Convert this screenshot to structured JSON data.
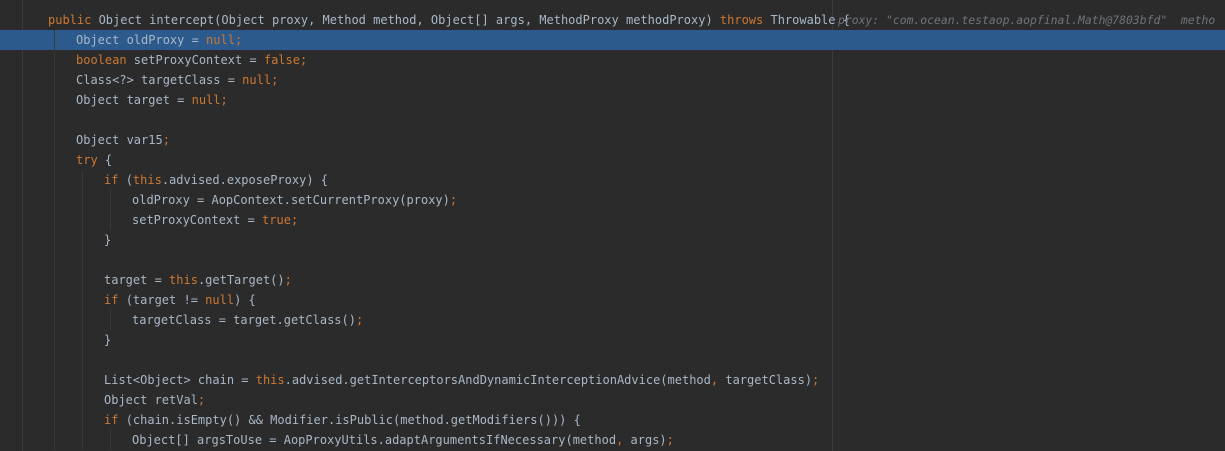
{
  "editor": {
    "inline_hint": "proxy: \"com.ocean.testaop.aopfinal.Math@7803bfd\"  metho",
    "lines": [
      {
        "indent": 1,
        "current": false,
        "tokens": [
          {
            "t": "public ",
            "c": "kw"
          },
          {
            "t": "Object intercept(Object proxy, Method method, Object[] args, MethodProxy methodProxy) ",
            "c": "pl"
          },
          {
            "t": "throws ",
            "c": "kw"
          },
          {
            "t": "Throwable {",
            "c": "pl"
          }
        ]
      },
      {
        "indent": 2,
        "current": true,
        "tokens": [
          {
            "t": "Object oldProxy = ",
            "c": "pl"
          },
          {
            "t": "null",
            "c": "kw"
          },
          {
            "t": ";",
            "c": "kw"
          }
        ]
      },
      {
        "indent": 2,
        "current": false,
        "tokens": [
          {
            "t": "boolean ",
            "c": "kw"
          },
          {
            "t": "setProxyContext = ",
            "c": "pl"
          },
          {
            "t": "false",
            "c": "kw"
          },
          {
            "t": ";",
            "c": "kw"
          }
        ]
      },
      {
        "indent": 2,
        "current": false,
        "tokens": [
          {
            "t": "Class<?> targetClass = ",
            "c": "pl"
          },
          {
            "t": "null",
            "c": "kw"
          },
          {
            "t": ";",
            "c": "kw"
          }
        ]
      },
      {
        "indent": 2,
        "current": false,
        "tokens": [
          {
            "t": "Object target = ",
            "c": "pl"
          },
          {
            "t": "null",
            "c": "kw"
          },
          {
            "t": ";",
            "c": "kw"
          }
        ]
      },
      {
        "indent": 2,
        "current": false,
        "tokens": []
      },
      {
        "indent": 2,
        "current": false,
        "tokens": [
          {
            "t": "Object var15",
            "c": "pl"
          },
          {
            "t": ";",
            "c": "kw"
          }
        ]
      },
      {
        "indent": 2,
        "current": false,
        "tokens": [
          {
            "t": "try ",
            "c": "kw"
          },
          {
            "t": "{",
            "c": "pl"
          }
        ]
      },
      {
        "indent": 3,
        "current": false,
        "tokens": [
          {
            "t": "if ",
            "c": "kw"
          },
          {
            "t": "(",
            "c": "pl"
          },
          {
            "t": "this",
            "c": "kw"
          },
          {
            "t": ".advised.exposeProxy) {",
            "c": "pl"
          }
        ]
      },
      {
        "indent": 4,
        "current": false,
        "tokens": [
          {
            "t": "oldProxy = AopContext.setCurrentProxy(proxy)",
            "c": "pl"
          },
          {
            "t": ";",
            "c": "kw"
          }
        ]
      },
      {
        "indent": 4,
        "current": false,
        "tokens": [
          {
            "t": "setProxyContext = ",
            "c": "pl"
          },
          {
            "t": "true",
            "c": "kw"
          },
          {
            "t": ";",
            "c": "kw"
          }
        ]
      },
      {
        "indent": 3,
        "current": false,
        "tokens": [
          {
            "t": "}",
            "c": "pl"
          }
        ]
      },
      {
        "indent": 3,
        "current": false,
        "tokens": []
      },
      {
        "indent": 3,
        "current": false,
        "tokens": [
          {
            "t": "target = ",
            "c": "pl"
          },
          {
            "t": "this",
            "c": "kw"
          },
          {
            "t": ".getTarget()",
            "c": "pl"
          },
          {
            "t": ";",
            "c": "kw"
          }
        ]
      },
      {
        "indent": 3,
        "current": false,
        "tokens": [
          {
            "t": "if ",
            "c": "kw"
          },
          {
            "t": "(target != ",
            "c": "pl"
          },
          {
            "t": "null",
            "c": "kw"
          },
          {
            "t": ") {",
            "c": "pl"
          }
        ]
      },
      {
        "indent": 4,
        "current": false,
        "tokens": [
          {
            "t": "targetClass = target.getClass()",
            "c": "pl"
          },
          {
            "t": ";",
            "c": "kw"
          }
        ]
      },
      {
        "indent": 3,
        "current": false,
        "tokens": [
          {
            "t": "}",
            "c": "pl"
          }
        ]
      },
      {
        "indent": 3,
        "current": false,
        "tokens": []
      },
      {
        "indent": 3,
        "current": false,
        "tokens": [
          {
            "t": "List<Object> chain = ",
            "c": "pl"
          },
          {
            "t": "this",
            "c": "kw"
          },
          {
            "t": ".advised.getInterceptorsAndDynamicInterceptionAdvice(method",
            "c": "pl"
          },
          {
            "t": ", ",
            "c": "kw"
          },
          {
            "t": "targetClass)",
            "c": "pl"
          },
          {
            "t": ";",
            "c": "kw"
          }
        ]
      },
      {
        "indent": 3,
        "current": false,
        "tokens": [
          {
            "t": "Object retVal",
            "c": "pl"
          },
          {
            "t": ";",
            "c": "kw"
          }
        ]
      },
      {
        "indent": 3,
        "current": false,
        "tokens": [
          {
            "t": "if ",
            "c": "kw"
          },
          {
            "t": "(chain.isEmpty() && Modifier.isPublic(method.getModifiers())) {",
            "c": "pl"
          }
        ]
      },
      {
        "indent": 4,
        "current": false,
        "tokens": [
          {
            "t": "Object[] argsToUse = AopProxyUtils.adaptArgumentsIfNecessary(method",
            "c": "pl"
          },
          {
            "t": ", ",
            "c": "kw"
          },
          {
            "t": "args)",
            "c": "pl"
          },
          {
            "t": ";",
            "c": "kw"
          }
        ]
      }
    ]
  }
}
